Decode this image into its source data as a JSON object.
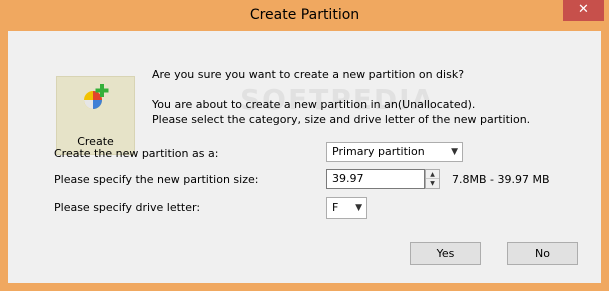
{
  "window": {
    "title": "Create Partition",
    "close_glyph": "✕"
  },
  "watermark": "SOFTPEDIA",
  "create_tile": {
    "label": "Create",
    "icon": "create-partition-icon"
  },
  "messages": {
    "confirm": "Are you sure you want to create a new partition on disk?",
    "about": "You are about to create a new partition in an(Unallocated).",
    "instructions": "Please select the category, size and drive letter of the new partition."
  },
  "form": {
    "type_label": "Create the new partition as a:",
    "type_value": "Primary partition",
    "size_label": "Please specify the new partition size:",
    "size_value": "39.97",
    "size_range": "7.8MB - 39.97 MB",
    "letter_label": "Please specify drive letter:",
    "letter_value": "F"
  },
  "buttons": {
    "yes": "Yes",
    "no": "No"
  }
}
